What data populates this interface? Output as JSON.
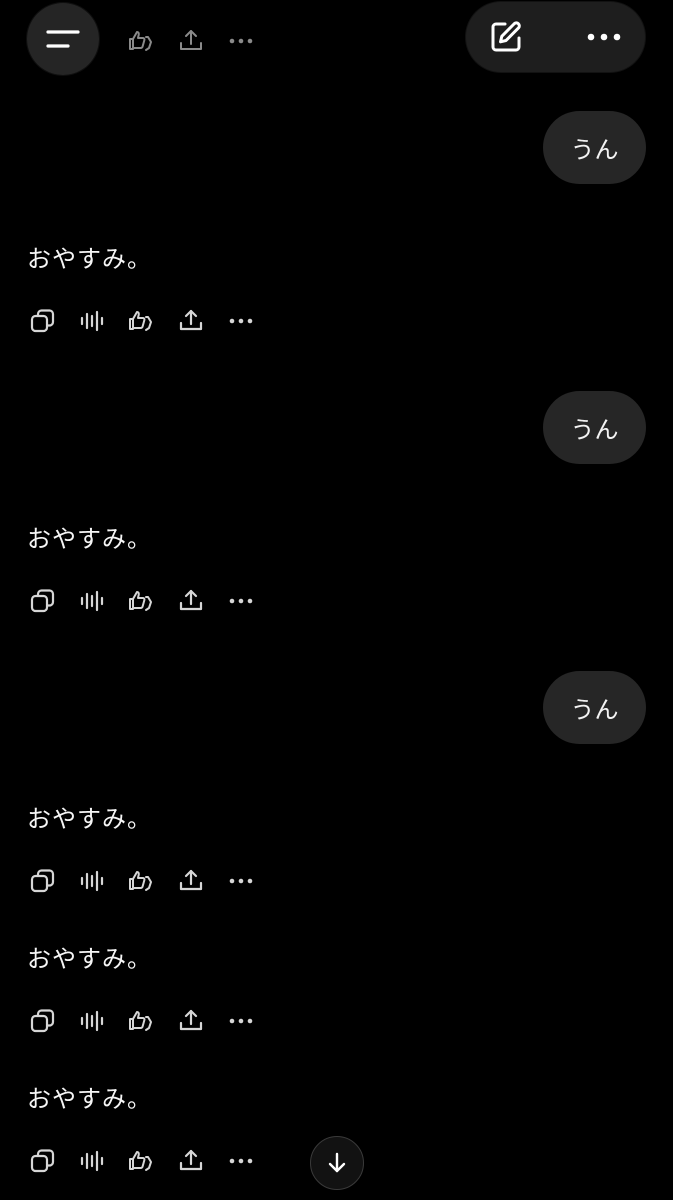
{
  "header": {
    "menu_icon": "menu-icon",
    "new_chat_icon": "edit-icon",
    "more_icon": "more-horizontal-icon"
  },
  "messages": [
    {
      "role": "user",
      "text": "うん"
    },
    {
      "role": "assistant",
      "text": "おやすみ。"
    },
    {
      "role": "user",
      "text": "うん"
    },
    {
      "role": "assistant",
      "text": "おやすみ。"
    },
    {
      "role": "user",
      "text": "うん"
    },
    {
      "role": "assistant",
      "text": "おやすみ。"
    },
    {
      "role": "assistant",
      "text": "おやすみ。"
    },
    {
      "role": "assistant",
      "text": "おやすみ。"
    }
  ],
  "action_icons": [
    "copy-icon",
    "read-aloud-icon",
    "feedback-icon",
    "share-icon",
    "more-horizontal-icon"
  ],
  "scroll_button_icon": "arrow-down-icon",
  "colors": {
    "background": "#000000",
    "user_bubble": "#262626",
    "text": "#f5f5f5",
    "icon": "#d6d6d6"
  }
}
